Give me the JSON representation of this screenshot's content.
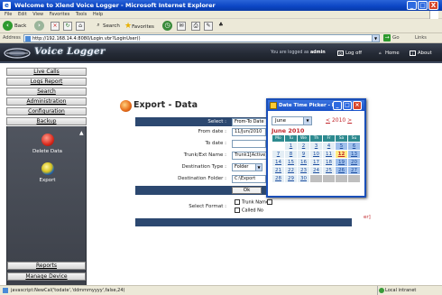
{
  "window": {
    "title": "Welcome to Xlend Voice Logger - Microsoft Internet Explorer",
    "buttons": [
      "_",
      "□",
      "X"
    ]
  },
  "menubar": [
    "File",
    "Edit",
    "View",
    "Favorites",
    "Tools",
    "Help"
  ],
  "toolbar": {
    "back": "Back",
    "search": "Search",
    "favorites": "Favorites"
  },
  "address": {
    "label": "Address",
    "url": "http://192.168.14.4:8080/Login.vbr?LoginUser()",
    "go": "Go",
    "links": "Links"
  },
  "banner": {
    "brand": "Voice Logger",
    "logged_prefix": "You are logged as",
    "user": "admin",
    "logoff": "Log off",
    "home": "Home",
    "about": "About"
  },
  "sidebar": {
    "items": [
      "Live Calls",
      "Logs Report",
      "Search",
      "Administration",
      "Configuration",
      "Backup"
    ],
    "panel_items": [
      "Delete Data",
      "Export"
    ],
    "bottom_items": [
      "Reports",
      "Manage Device"
    ]
  },
  "page": {
    "title": "Export - Data"
  },
  "form": {
    "select_label": "Select :",
    "select_value": "From-To Date",
    "from_label": "From date :",
    "from_value": "11/Jun/2010",
    "to_label": "To date :",
    "to_value": "",
    "trunk_label": "Trunk/Ext Name :",
    "trunk_value": "Trunk1[Active]",
    "dest_type_label": "Destination Type :",
    "dest_type_value": "Folder",
    "dest_folder_label": "Destination Folder :",
    "dest_folder_value": "C:\\Export",
    "ok": "Ok",
    "select_format_label": "Select Format :",
    "opt_trunk": "Trunk Name",
    "opt_called": "Called No"
  },
  "datepicker": {
    "title": "Date Time Picker - M...",
    "month": "June",
    "year_nav": "2010",
    "year_prev": "<",
    "year_next": ">",
    "heading": "June 2010",
    "days": [
      "Mo",
      "Tu",
      "We",
      "Th",
      "Fr",
      "Sa",
      "Su"
    ],
    "weeks": [
      [
        "",
        "1",
        "2",
        "3",
        "4",
        "5",
        "6"
      ],
      [
        "7",
        "8",
        "9",
        "10",
        "11",
        "12",
        "13"
      ],
      [
        "14",
        "15",
        "16",
        "17",
        "18",
        "19",
        "20"
      ],
      [
        "21",
        "22",
        "23",
        "24",
        "25",
        "26",
        "27"
      ],
      [
        "28",
        "29",
        "30",
        "",
        "",
        "",
        ""
      ]
    ],
    "today": "12"
  },
  "behind_text": "er]",
  "status": {
    "text": "javascript:NewCal('todate','ddmmmyyyy',false,24)",
    "zone": "Local intranet"
  },
  "colors": {
    "titlebar": "#0b45c4",
    "banner": "#252b36",
    "form_header": "#2c4870",
    "accent_red": "#c2282d"
  }
}
